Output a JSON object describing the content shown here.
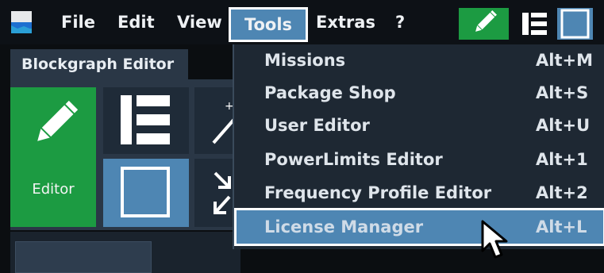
{
  "menubar": {
    "file": "File",
    "edit": "Edit",
    "view": "View",
    "tools": "Tools",
    "extras": "Extras",
    "help": "?"
  },
  "toolbar": {
    "icons": [
      "pencil-icon",
      "list-icon",
      "block-icon"
    ]
  },
  "panel": {
    "tab_title": "Blockgraph Editor",
    "editor_label": "Editor"
  },
  "tools_menu": {
    "items": [
      {
        "label": "Missions",
        "shortcut": "Alt+M"
      },
      {
        "label": "Package Shop",
        "shortcut": "Alt+S"
      },
      {
        "label": "User Editor",
        "shortcut": "Alt+U"
      },
      {
        "label": "PowerLimits Editor",
        "shortcut": "Alt+1"
      },
      {
        "label": "Frequency Profile Editor",
        "shortcut": "Alt+2"
      },
      {
        "label": "License Manager",
        "shortcut": "Alt+L"
      }
    ],
    "selected_index": 5
  },
  "colors": {
    "accent_blue": "#4e86b3",
    "accent_green": "#1c9b42",
    "background": "#0b0e11",
    "menu_bg": "#1e2833"
  }
}
